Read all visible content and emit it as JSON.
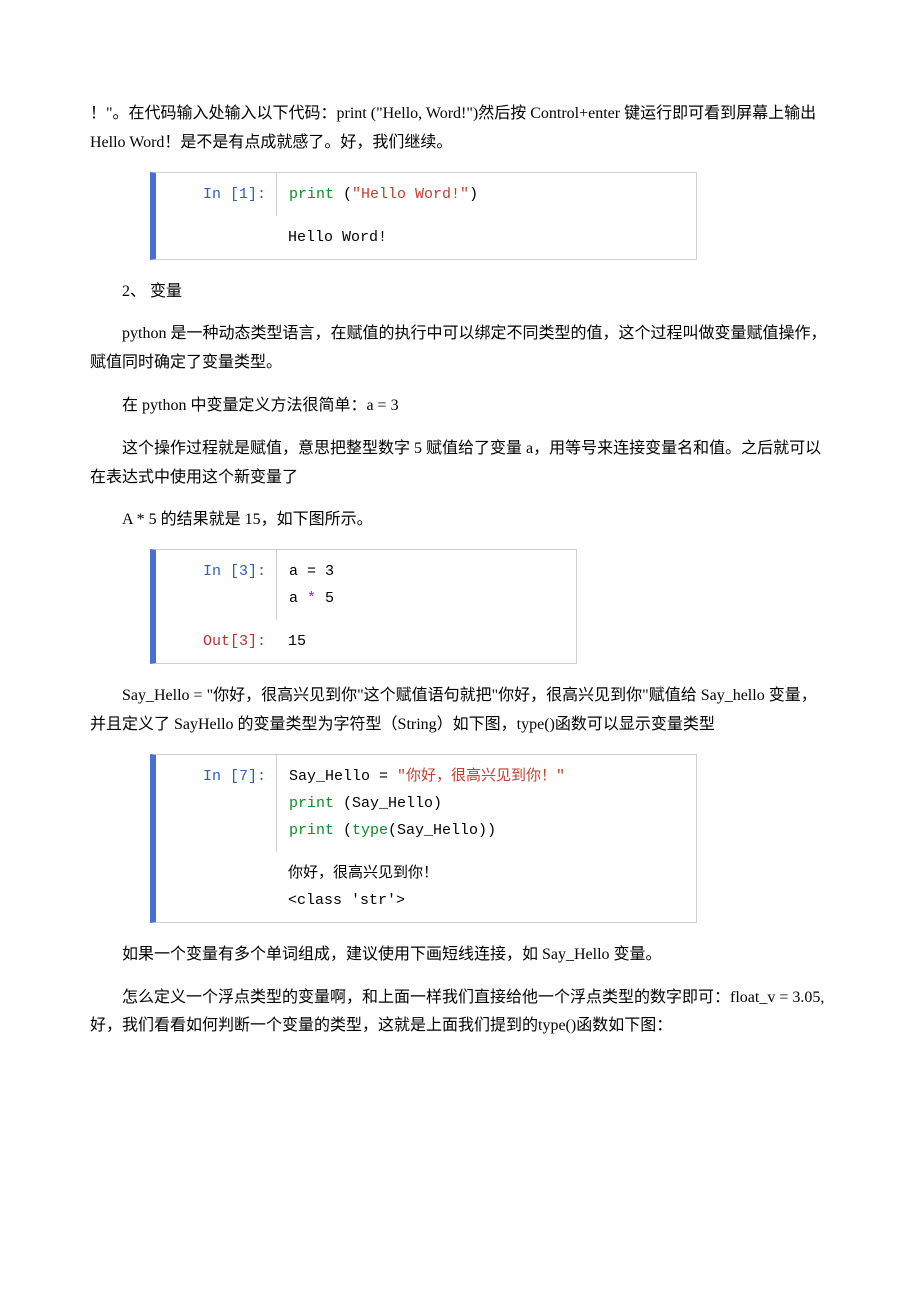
{
  "para1": "！\"。在代码输入处输入以下代码：print (\"Hello, Word!\")然后按 Control+enter 键运行即可看到屏幕上输出 Hello Word！是不是有点成就感了。好，我们继续。",
  "cell1": {
    "in_label": "In  [1]:",
    "code_fn": "print",
    "code_paren_open": " (",
    "code_str": "\"Hello Word!\"",
    "code_paren_close": ")",
    "output": "Hello Word!"
  },
  "para2": "2、 变量",
  "para3": "python 是一种动态类型语言，在赋值的执行中可以绑定不同类型的值，这个过程叫做变量赋值操作，赋值同时确定了变量类型。",
  "para4": "在 python 中变量定义方法很简单：a = 3",
  "para5": "这个操作过程就是赋值，意思把整型数字 5 赋值给了变量 a，用等号来连接变量名和值。之后就可以在表达式中使用这个新变量了",
  "para6": "A * 5 的结果就是 15，如下图所示。",
  "cell2": {
    "in_label": "In  [3]:",
    "line1": "a = 3",
    "line2_a": "a ",
    "line2_op": "*",
    "line2_b": " 5",
    "out_label": "Out[3]:",
    "out_value": "15"
  },
  "para7": "Say_Hello = \"你好，很高兴见到你\"这个赋值语句就把\"你好，很高兴见到你\"赋值给 Say_hello 变量，并且定义了 SayHello 的变量类型为字符型（String）如下图，type()函数可以显示变量类型",
  "cell3": {
    "in_label": "In  [7]:",
    "l1_a": "Say_Hello = ",
    "l1_str": "\"你好，很高兴见到你！\"",
    "l2_fn": "print",
    "l2_rest": " (Say_Hello)",
    "l3_fn1": "print",
    "l3_mid": " (",
    "l3_fn2": "type",
    "l3_rest": "(Say_Hello))",
    "out1": "你好，很高兴见到你！",
    "out2": "<class 'str'>"
  },
  "para8": "如果一个变量有多个单词组成，建议使用下画短线连接，如 Say_Hello 变量。",
  "para9": "怎么定义一个浮点类型的变量啊，和上面一样我们直接给他一个浮点类型的数字即可：float_v = 3.05,好，我们看看如何判断一个变量的类型，这就是上面我们提到的type()函数如下图："
}
